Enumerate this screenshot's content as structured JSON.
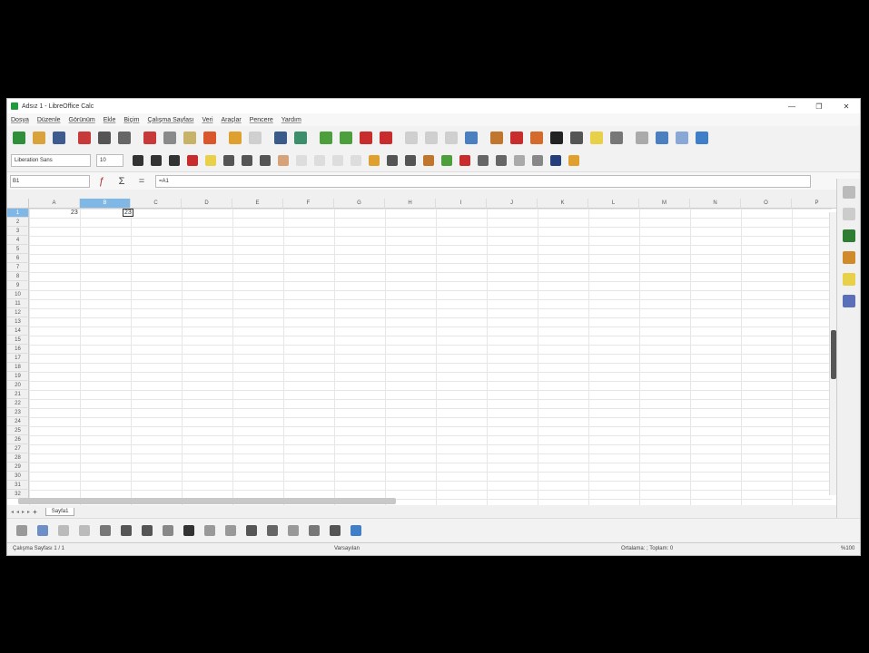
{
  "window": {
    "title": "Adsız 1 - LibreOffice Calc",
    "minimize": "—",
    "maximize": "❐",
    "close": "✕"
  },
  "menu": [
    "Dosya",
    "Düzenle",
    "Görünüm",
    "Ekle",
    "Biçim",
    "Çalışma Sayfası",
    "Veri",
    "Araçlar",
    "Pencere",
    "Yardım"
  ],
  "format": {
    "font_name": "Liberation Sans",
    "font_size": "10"
  },
  "formula_bar": {
    "name_box": "B1",
    "content": "=A1"
  },
  "columns": [
    "A",
    "B",
    "C",
    "D",
    "E",
    "F",
    "G",
    "H",
    "I",
    "J",
    "K",
    "L",
    "M",
    "N",
    "O",
    "P"
  ],
  "rows": [
    "1",
    "2",
    "3",
    "4",
    "5",
    "6",
    "7",
    "8",
    "9",
    "10",
    "11",
    "12",
    "13",
    "14",
    "15",
    "16",
    "17",
    "18",
    "19",
    "20",
    "21",
    "22",
    "23",
    "24",
    "25",
    "26",
    "27",
    "28",
    "29",
    "30",
    "31",
    "32"
  ],
  "cells": {
    "A1": "23",
    "B1": "23"
  },
  "sheet_tabs": [
    "Sayfa1"
  ],
  "status": {
    "sheet": "Çalışma Sayfası 1 / 1",
    "language": "Varsayılan",
    "summary": "Ortalama: ; Toplam: 0",
    "zoom": "%100"
  },
  "colors": {
    "selection": "#7fb7e6"
  }
}
